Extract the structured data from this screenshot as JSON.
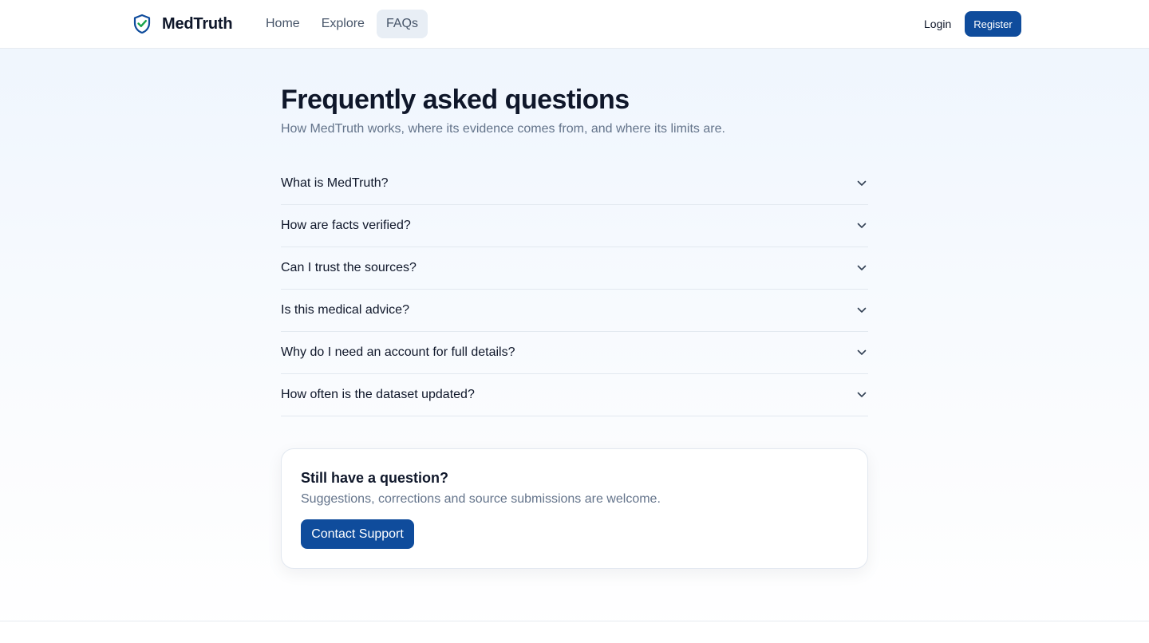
{
  "header": {
    "brand_name": "MedTruth",
    "brand_icon": "shield-check-icon",
    "nav": [
      {
        "label": "Home",
        "active": false
      },
      {
        "label": "Explore",
        "active": false
      },
      {
        "label": "FAQs",
        "active": true
      }
    ],
    "login_label": "Login",
    "register_label": "Register"
  },
  "main": {
    "title": "Frequently asked questions",
    "subtitle": "How MedTruth works, where its evidence comes from, and where its limits are.",
    "faqs": [
      {
        "question": "What is MedTruth?",
        "icon": "chevron-down-icon"
      },
      {
        "question": "How are facts verified?",
        "icon": "chevron-down-icon"
      },
      {
        "question": "Can I trust the sources?",
        "icon": "chevron-down-icon"
      },
      {
        "question": "Is this medical advice?",
        "icon": "chevron-down-icon"
      },
      {
        "question": "Why do I need an account for full details?",
        "icon": "chevron-down-icon"
      },
      {
        "question": "How often is the dataset updated?",
        "icon": "chevron-down-icon"
      }
    ]
  },
  "support_card": {
    "title": "Still have a question?",
    "text": "Suggestions, corrections and source submissions are welcome.",
    "button_label": "Contact Support"
  },
  "colors": {
    "primary": "#0f4c9c",
    "text": "#0f172a",
    "muted": "#64748b"
  }
}
